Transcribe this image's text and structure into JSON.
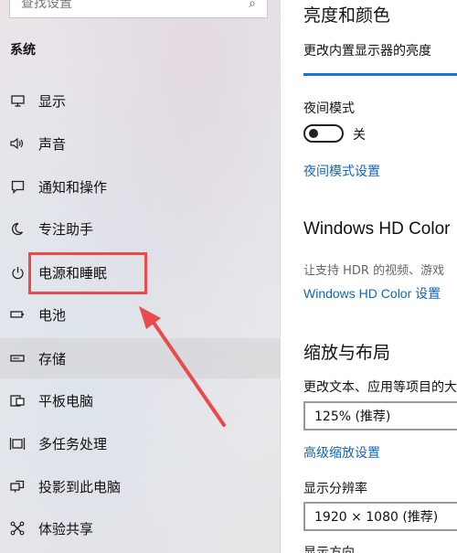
{
  "sidebar": {
    "search_placeholder": "查找设置",
    "section_title": "系统",
    "items": [
      {
        "label": "显示",
        "icon": "monitor-icon"
      },
      {
        "label": "声音",
        "icon": "speaker-icon"
      },
      {
        "label": "通知和操作",
        "icon": "notification-icon"
      },
      {
        "label": "专注助手",
        "icon": "moon-icon"
      },
      {
        "label": "电源和睡眠",
        "icon": "power-icon"
      },
      {
        "label": "电池",
        "icon": "battery-icon"
      },
      {
        "label": "存储",
        "icon": "storage-icon"
      },
      {
        "label": "平板电脑",
        "icon": "tablet-icon"
      },
      {
        "label": "多任务处理",
        "icon": "multitask-icon"
      },
      {
        "label": "投影到此电脑",
        "icon": "project-icon"
      },
      {
        "label": "体验共享",
        "icon": "share-icon"
      }
    ],
    "selected_item": "存储"
  },
  "main": {
    "brightness_title": "亮度和颜色",
    "brightness_label": "更改内置显示器的亮度",
    "night_mode_label": "夜间模式",
    "night_mode_state": "关",
    "night_mode_settings_link": "夜间模式设置",
    "hdr_title": "Windows HD Color",
    "hdr_desc": "让支持 HDR 的视频、游戏",
    "hdr_link": "Windows HD Color 设置",
    "scale_title": "缩放与布局",
    "scale_label": "更改文本、应用等项目的大",
    "scale_value": "125% (推荐)",
    "advanced_scale_link": "高级缩放设置",
    "resolution_label": "显示分辨率",
    "resolution_value": "1920 × 1080 (推荐)",
    "orientation_label": "显示方向"
  },
  "colors": {
    "accent": "#1a73d0",
    "link": "#1565b8",
    "annotation": "#ea4a4a"
  }
}
